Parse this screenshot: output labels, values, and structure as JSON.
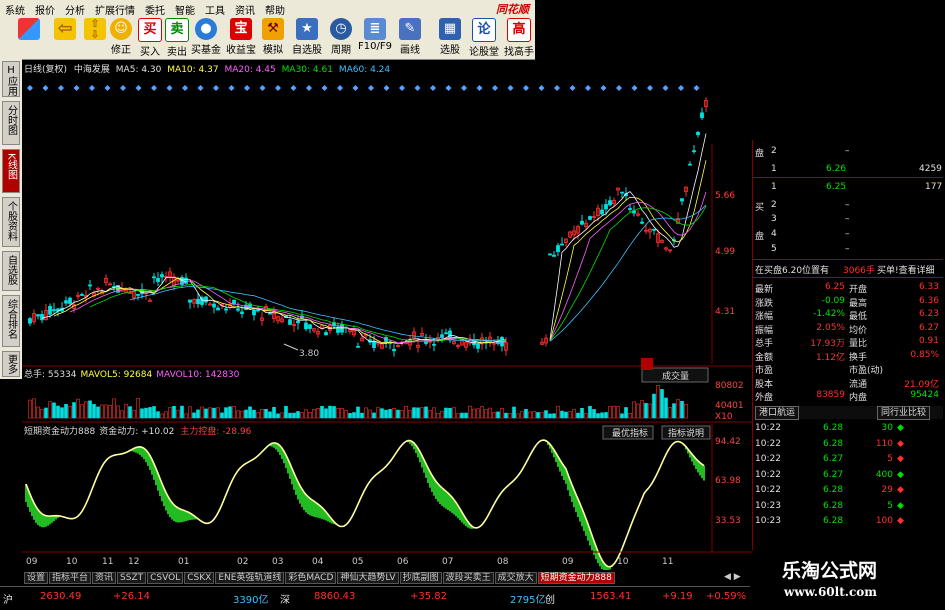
{
  "app": {
    "brand": "同花顺"
  },
  "menu": [
    "系统",
    "报价",
    "分析",
    "扩展行情",
    "委托",
    "智能",
    "工具",
    "资讯",
    "帮助"
  ],
  "toolbar": [
    {
      "label": "",
      "icon": "layout-icon"
    },
    {
      "label": "",
      "icon": "back-arrow-icon"
    },
    {
      "label": "",
      "icon": "up-down-icon"
    },
    {
      "label": "修正",
      "icon": "smile-icon"
    },
    {
      "label": "买入",
      "icon": "buy-icon",
      "glyph": "买"
    },
    {
      "label": "卖出",
      "icon": "sell-icon",
      "glyph": "卖"
    },
    {
      "label": "买基金",
      "icon": "fund-icon"
    },
    {
      "label": "收益宝",
      "icon": "treasure-icon",
      "glyph": "宝"
    },
    {
      "label": "模拟",
      "icon": "hammer-icon"
    },
    {
      "label": "自选股",
      "icon": "star-icon"
    },
    {
      "label": "周期",
      "icon": "clock-icon"
    },
    {
      "label": "F10/F9",
      "icon": "doc-icon"
    },
    {
      "label": "画线",
      "icon": "pencil-icon"
    },
    {
      "label": "选股",
      "icon": "select-icon"
    },
    {
      "label": "论股堂",
      "icon": "forum-icon",
      "glyph": "论"
    },
    {
      "label": "找高手",
      "icon": "expert-icon",
      "glyph": "高"
    }
  ],
  "lefttabs": [
    "应用",
    "分时图",
    "K线图",
    "个股资料",
    "自选股",
    "综合排名",
    "更多"
  ],
  "info": {
    "period": "日线(复权)",
    "stock": "中海发展",
    "ma5": "MA5: 4.30",
    "ma10": "MA10: 4.37",
    "ma20": "MA20: 4.45",
    "ma30": "MA30: 4.61",
    "ma60": "MA60: 4.24"
  },
  "price_axis": [
    "5.66",
    "4.99",
    "4.31"
  ],
  "low_label": "3.80",
  "volume": {
    "title": "总手: 55334",
    "mavol5": "MAVOL5: 92684",
    "mavol10": "MAVOL10: 142830",
    "axis": [
      "80802",
      "40401",
      "X10"
    ],
    "tab": "成交量"
  },
  "indicator": {
    "title": "短期资金动力888",
    "line1": "资金动力: +10.02",
    "line2": "主力控盘: -28.96",
    "axis": [
      "94.42",
      "63.98",
      "33.53"
    ],
    "btn1": "最优指标",
    "btn2": "指标说明"
  },
  "xaxis": [
    "09",
    "10",
    "11",
    "12",
    "01",
    "02",
    "03",
    "04",
    "05",
    "06",
    "07",
    "08",
    "09",
    "10",
    "11"
  ],
  "orderbook": {
    "sell_label": "盘",
    "buy_label1": "买",
    "buy_label2": "盘",
    "rows": [
      {
        "n": "2",
        "p": "",
        "v": ""
      },
      {
        "n": "1",
        "p": "6.26",
        "v": "4259"
      },
      {
        "n": "1",
        "p": "6.25",
        "v": "177"
      },
      {
        "n": "2",
        "p": "",
        "v": ""
      },
      {
        "n": "3",
        "p": "",
        "v": ""
      },
      {
        "n": "4",
        "p": "",
        "v": ""
      },
      {
        "n": "5",
        "p": "",
        "v": ""
      }
    ]
  },
  "alert": {
    "text": "在买盘6.20位置有",
    "qty": "3066手",
    "action": "买单!查看详细"
  },
  "quote": [
    {
      "l": "最新",
      "v": "6.25",
      "l2": "开盘",
      "v2": "6.33"
    },
    {
      "l": "涨跌",
      "v": "-0.09",
      "l2": "最高",
      "v2": "6.36"
    },
    {
      "l": "涨幅",
      "v": "-1.42%",
      "l2": "最低",
      "v2": "6.23"
    },
    {
      "l": "振幅",
      "v": "2.05%",
      "l2": "均价",
      "v2": "6.27"
    },
    {
      "l": "总手",
      "v": "17.93万",
      "l2": "量比",
      "v2": "0.91"
    },
    {
      "l": "金额",
      "v": "1.12亿",
      "l2": "换手",
      "v2": "0.85%"
    },
    {
      "l": "市盈",
      "v": "",
      "l2": "市盈(动)",
      "v2": ""
    },
    {
      "l": "股本",
      "v": "",
      "l2": "流通",
      "v2": "21.09亿"
    },
    {
      "l": "外盘",
      "v": "83859",
      "l2": "内盘",
      "v2": "95424"
    }
  ],
  "tabs_right": [
    "港口航运",
    "同行业比较"
  ],
  "ticks": [
    {
      "t": "10:22",
      "p": "6.28",
      "v": "30"
    },
    {
      "t": "10:22",
      "p": "6.28",
      "v": "110"
    },
    {
      "t": "10:22",
      "p": "6.27",
      "v": "5"
    },
    {
      "t": "10:22",
      "p": "6.27",
      "v": "400"
    },
    {
      "t": "10:22",
      "p": "6.28",
      "v": "29"
    },
    {
      "t": "10:23",
      "p": "6.28",
      "v": "5"
    },
    {
      "t": "10:23",
      "p": "6.28",
      "v": "100"
    }
  ],
  "bottom_tabs": [
    "设置",
    "指标平台",
    "资讯",
    "SSZT",
    "CSVOL",
    "CSKX",
    "ENE英强轨道线",
    "彩色MACD",
    "神仙大趋势LV",
    "抄底副图",
    "波段买卖王",
    "成交放大",
    "短期资金动力888"
  ],
  "status": {
    "sh_label": "沪",
    "sh_index": "2630.49",
    "sh_chg": "+26.14",
    "sh_amt": "3390亿",
    "sz_label": "深",
    "sz_index": "8860.43",
    "sz_chg": "+35.82",
    "sz_amt": "2795亿",
    "cy_label": "创",
    "cy_index": "1563.41",
    "cy_chg": "+9.19",
    "cy_pct": "+0.59%"
  },
  "watermark": {
    "line1": "乐淘公式网",
    "line2": "www.60lt.com"
  },
  "colors": {
    "up": "#ff3030",
    "down": "#00e000",
    "indicator_fill": "#22bb22",
    "indicator_line": "#ffffa0"
  }
}
